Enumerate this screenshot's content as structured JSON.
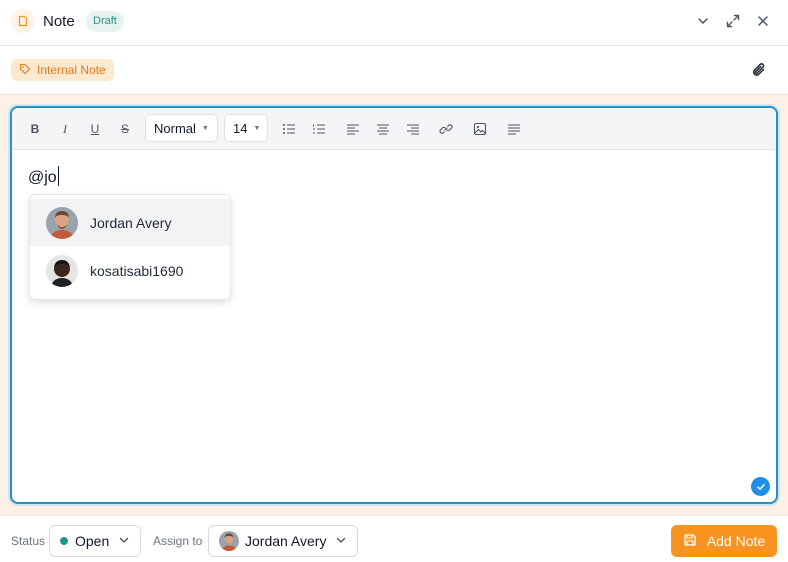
{
  "header": {
    "title": "Note",
    "badge": "Draft",
    "icons": [
      "note-icon",
      "chevron-down-icon",
      "expand-icon",
      "close-icon"
    ]
  },
  "tag": {
    "label": "Internal Note",
    "icon": "tag-icon"
  },
  "toolbar": {
    "bold": "B",
    "italic": "I",
    "underline": "U",
    "strike": "S",
    "style_value": "Normal",
    "size_value": "14"
  },
  "editor": {
    "content": "@jo",
    "mentions": [
      {
        "name": "Jordan Avery"
      },
      {
        "name": "kosatisabi1690"
      }
    ]
  },
  "footer": {
    "status_label": "Status",
    "status_value": "Open",
    "assign_label": "Assign to",
    "assign_value": "Jordan Avery",
    "add_button": "Add Note"
  },
  "colors": {
    "accent_orange": "#f7931e",
    "editor_border": "#2b8fbf",
    "status_green": "#21958a",
    "badge_bg": "#e6f3f1"
  }
}
